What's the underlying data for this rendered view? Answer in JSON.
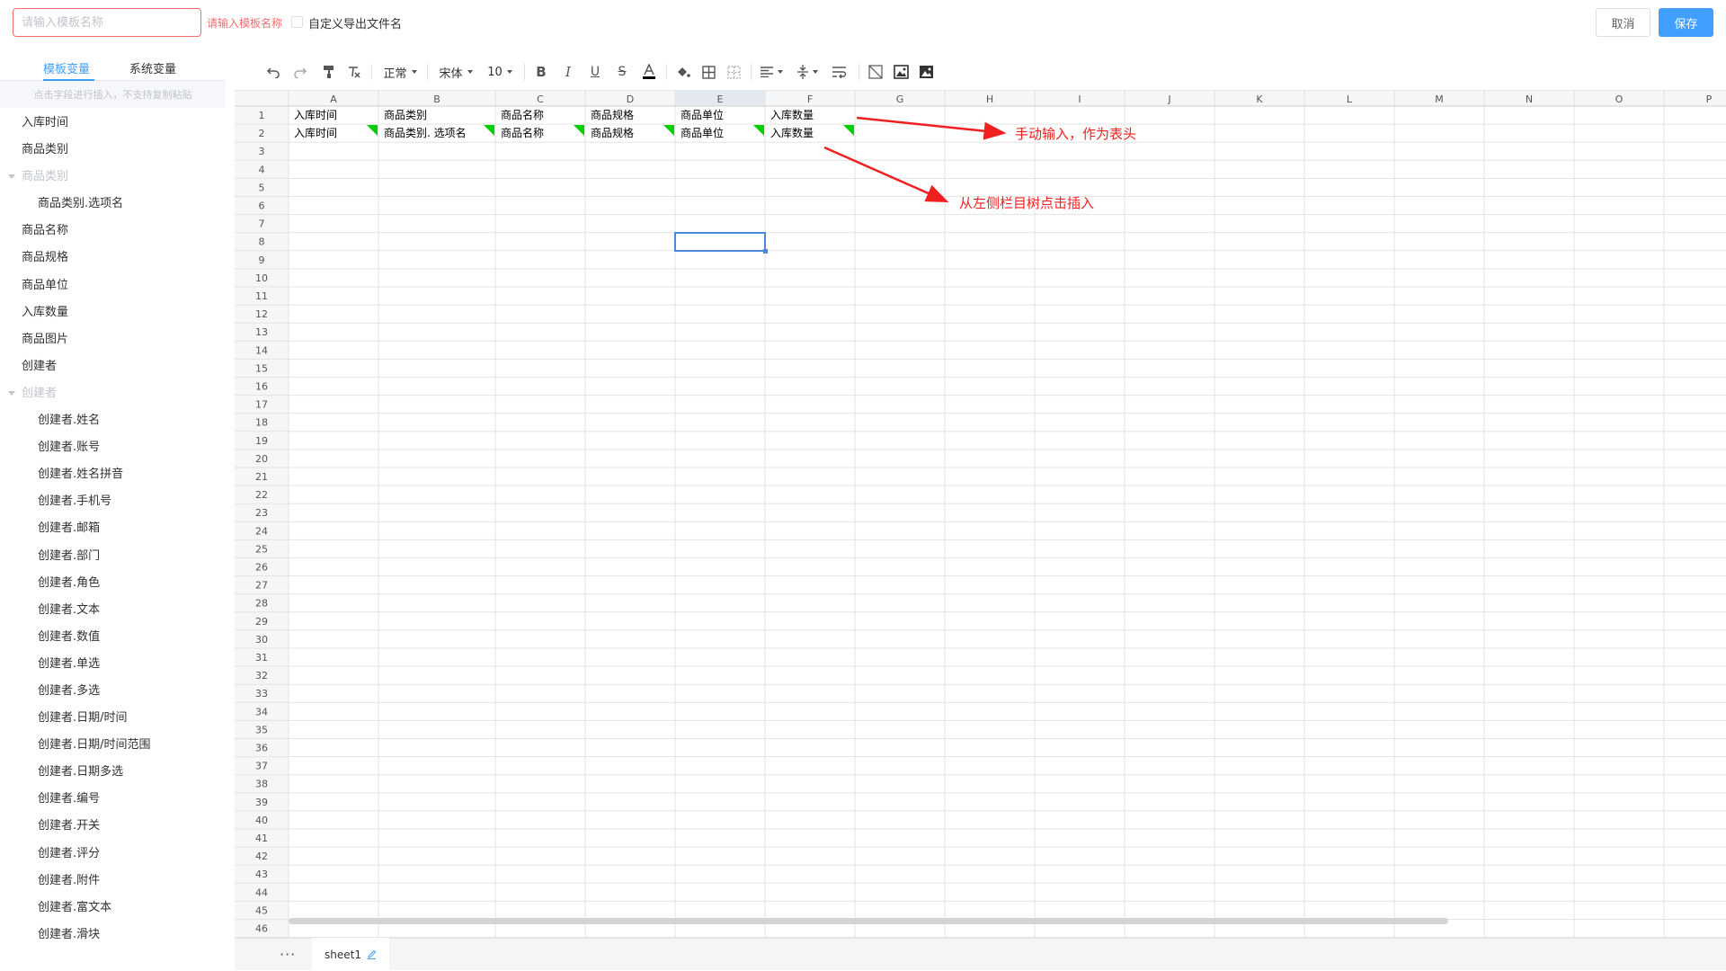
{
  "header": {
    "template_name_placeholder": "请输入模板名称",
    "template_name_error": "请输入模板名称",
    "custom_filename_label": "自定义导出文件名",
    "cancel_label": "取消",
    "save_label": "保存"
  },
  "sidebar": {
    "tabs": [
      {
        "label": "模板变量",
        "active": true
      },
      {
        "label": "系统变量",
        "active": false
      }
    ],
    "hint": "点击字段进行插入，不支持复制粘贴",
    "items": [
      {
        "label": "入库时间",
        "type": "field"
      },
      {
        "label": "商品类别",
        "type": "field"
      },
      {
        "label": "商品类别",
        "type": "group"
      },
      {
        "label": "商品类别.选项名",
        "type": "child"
      },
      {
        "label": "商品名称",
        "type": "field"
      },
      {
        "label": "商品规格",
        "type": "field"
      },
      {
        "label": "商品单位",
        "type": "field"
      },
      {
        "label": "入库数量",
        "type": "field"
      },
      {
        "label": "商品图片",
        "type": "field"
      },
      {
        "label": "创建者",
        "type": "field"
      },
      {
        "label": "创建者",
        "type": "group"
      },
      {
        "label": "创建者.姓名",
        "type": "child"
      },
      {
        "label": "创建者.账号",
        "type": "child"
      },
      {
        "label": "创建者.姓名拼音",
        "type": "child"
      },
      {
        "label": "创建者.手机号",
        "type": "child"
      },
      {
        "label": "创建者.邮箱",
        "type": "child"
      },
      {
        "label": "创建者.部门",
        "type": "child"
      },
      {
        "label": "创建者.角色",
        "type": "child"
      },
      {
        "label": "创建者.文本",
        "type": "child"
      },
      {
        "label": "创建者.数值",
        "type": "child"
      },
      {
        "label": "创建者.单选",
        "type": "child"
      },
      {
        "label": "创建者.多选",
        "type": "child"
      },
      {
        "label": "创建者.日期/时间",
        "type": "child"
      },
      {
        "label": "创建者.日期/时间范围",
        "type": "child"
      },
      {
        "label": "创建者.日期多选",
        "type": "child"
      },
      {
        "label": "创建者.编号",
        "type": "child"
      },
      {
        "label": "创建者.开关",
        "type": "child"
      },
      {
        "label": "创建者.评分",
        "type": "child"
      },
      {
        "label": "创建者.附件",
        "type": "child"
      },
      {
        "label": "创建者.富文本",
        "type": "child"
      },
      {
        "label": "创建者.滑块",
        "type": "child"
      }
    ]
  },
  "toolbar": {
    "style_value": "正常",
    "font_value": "宋体",
    "size_value": "10"
  },
  "sheet": {
    "columns": [
      "A",
      "B",
      "C",
      "D",
      "E",
      "F",
      "G",
      "H",
      "I",
      "J",
      "K",
      "L",
      "M",
      "N",
      "O",
      "P"
    ],
    "active_column": "E",
    "row_count": 46,
    "rows": [
      [
        "入库时间",
        "商品类别",
        "商品名称",
        "商品规格",
        "商品单位",
        "入库数量"
      ],
      [
        "入库时间",
        "商品类别. 选项名",
        "商品名称",
        "商品规格",
        "商品单位",
        "入库数量"
      ]
    ],
    "flagged_row": 2,
    "selected_cell": "E8",
    "tab_name": "sheet1",
    "more_label": "···"
  },
  "annotations": {
    "header_note": "手动输入，作为表头",
    "insert_note": "从左侧栏目树点击插入"
  },
  "colors": {
    "primary": "#409eff",
    "error": "#f56c6c",
    "annotation": "#f02020",
    "flag": "#00d000",
    "selection": "#4a89dc"
  }
}
